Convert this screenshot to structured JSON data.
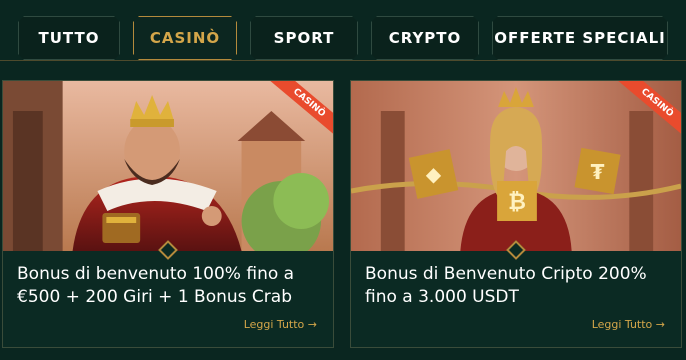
{
  "tabs": [
    {
      "label": "TUTTO",
      "active": false
    },
    {
      "label": "CASINÒ",
      "active": true
    },
    {
      "label": "SPORT",
      "active": false
    },
    {
      "label": "CRYPTO",
      "active": false
    },
    {
      "label": "OFFERTE SPECIALI",
      "active": false
    }
  ],
  "cards": [
    {
      "badge": "CASINÒ",
      "image_alt_icon": "king-icon",
      "line1": "Bonus di benvenuto 100% fino a",
      "line2": "€500 + 200 Giri + 1 Bonus Crab",
      "link": "Leggi Tutto →"
    },
    {
      "badge": "CASINÒ",
      "image_alt_icon": "queen-crypto-icon",
      "line1": "Bonus di Benvenuto Cripto 200%",
      "line2": "fino a 3.000 USDT",
      "link": "Leggi Tutto →"
    }
  ],
  "colors": {
    "accent": "#d4a64a",
    "background": "#0a2620",
    "badge": "#e94b2d"
  }
}
